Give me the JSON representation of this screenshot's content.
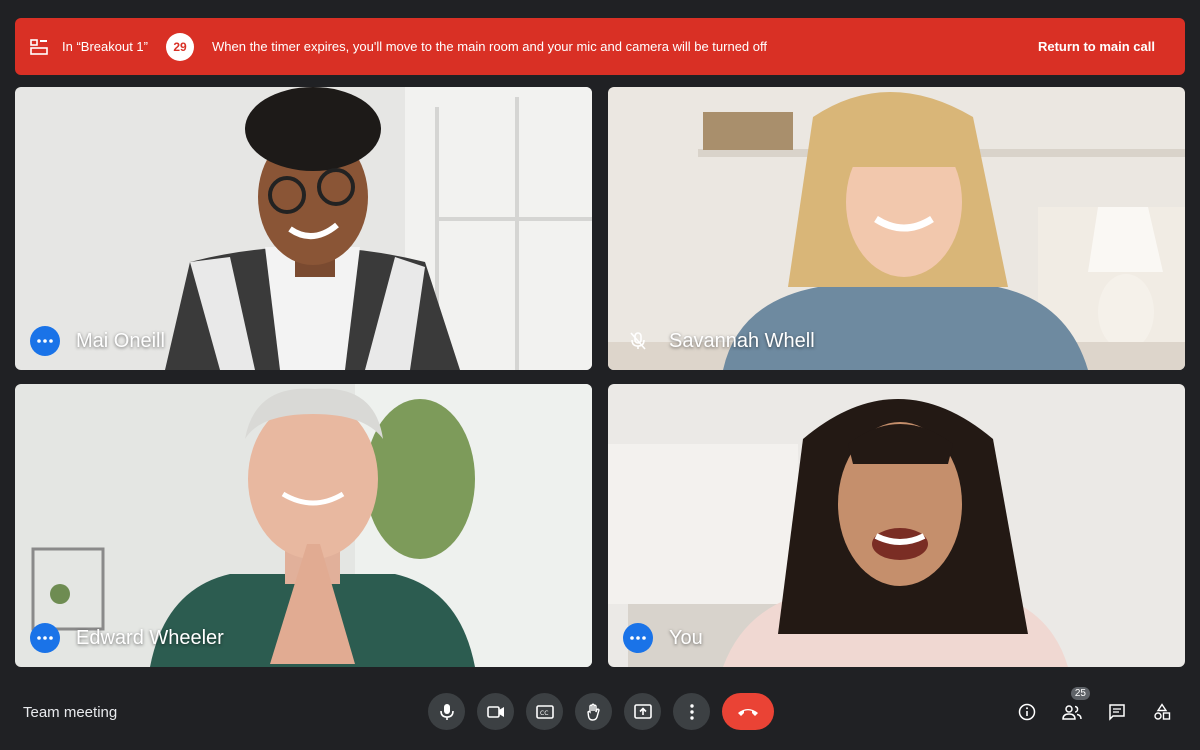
{
  "banner": {
    "room_label": "In “Breakout 1”",
    "countdown": "29",
    "message": "When the timer expires, you'll move to the main room and your mic and camera will be turned off",
    "return_label": "Return to main call",
    "color": "#d93025"
  },
  "participants": [
    {
      "name": "Mai Oneill",
      "indicator": "more-options"
    },
    {
      "name": "Savannah Whell",
      "indicator": "mic-off"
    },
    {
      "name": "Edward Wheeler",
      "indicator": "more-options"
    },
    {
      "name": "You",
      "indicator": "more-options"
    }
  ],
  "bottom_bar": {
    "meeting_title": "Team meeting",
    "controls": [
      "mic-icon",
      "camera-icon",
      "captions-icon",
      "raise-hand-icon",
      "present-icon",
      "more-vert-icon",
      "end-call-icon"
    ],
    "end_call_color": "#ea4335",
    "people_count": "25",
    "right_actions": [
      "info-icon",
      "people-icon",
      "chat-icon",
      "activities-icon"
    ]
  },
  "colors": {
    "background": "#202124",
    "control_bg": "#3c4043",
    "accent_blue": "#1a73e8"
  }
}
